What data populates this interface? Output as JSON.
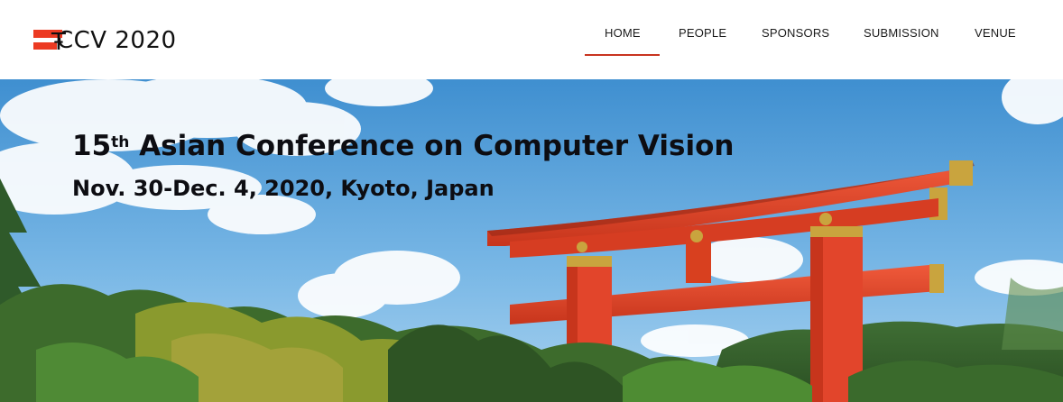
{
  "logo": {
    "text": "CCV 2020",
    "mark_glyph": "Ŧ",
    "brand_color": "#ec3a22"
  },
  "nav": {
    "items": [
      {
        "label": "HOME",
        "active": true
      },
      {
        "label": "PEOPLE",
        "active": false
      },
      {
        "label": "SPONSORS",
        "active": false
      },
      {
        "label": "SUBMISSION",
        "active": false
      },
      {
        "label": "VENUE",
        "active": false
      }
    ],
    "active_color": "#c8341f"
  },
  "hero": {
    "ordinal_number": "15",
    "ordinal_suffix": "th",
    "title_rest": " Asian Conference on Computer Vision",
    "subtitle": "Nov. 30-Dec. 4, 2020, Kyoto, Japan",
    "torii_color": "#e2452b",
    "sky_color": "#5aa3d8"
  }
}
